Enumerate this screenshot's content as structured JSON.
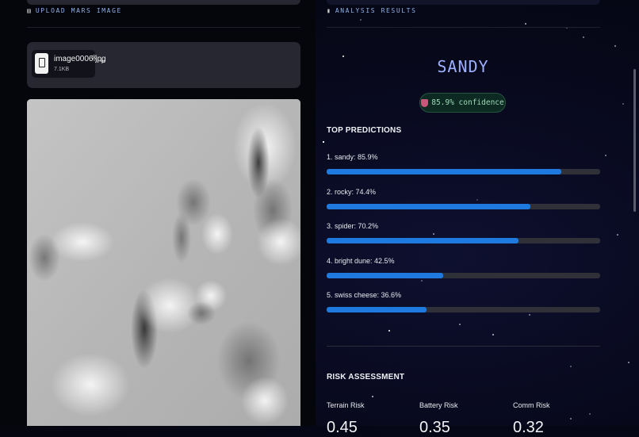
{
  "upload": {
    "section_icon": "▤",
    "section_title": "UPLOAD MARS IMAGE",
    "file": {
      "name": "image0006.jpg",
      "size": "7.1KB"
    },
    "close_icon": "⊗",
    "add_icon": "+"
  },
  "analysis": {
    "section_icon": "▮",
    "section_title": "ANALYSIS RESULTS",
    "prediction": "SANDY",
    "confidence": "85.9% confidence",
    "top_predictions_title": "TOP PREDICTIONS",
    "predictions": [
      {
        "label": "1. sandy: 85.9%",
        "value": 0.859
      },
      {
        "label": "2. rocky: 74.4%",
        "value": 0.744
      },
      {
        "label": "3. spider: 70.2%",
        "value": 0.702
      },
      {
        "label": "4. bright dune: 42.5%",
        "value": 0.425
      },
      {
        "label": "5. swiss cheese: 36.6%",
        "value": 0.366
      }
    ],
    "risk_title": "RISK ASSESSMENT",
    "risks": [
      {
        "label": "Terrain Risk",
        "value": "0.45"
      },
      {
        "label": "Battery Risk",
        "value": "0.35"
      },
      {
        "label": "Comm Risk",
        "value": "0.32"
      }
    ]
  },
  "colors": {
    "accent": "#1f7ae0",
    "track": "#2f3038",
    "badge_text": "#9fd9b8",
    "title": "#9db0ff"
  }
}
